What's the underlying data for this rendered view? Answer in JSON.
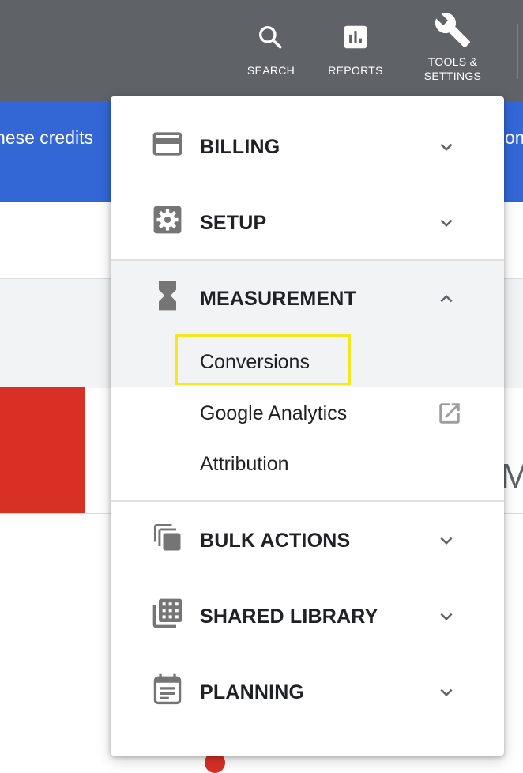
{
  "topbar": {
    "search_label": "SEARCH",
    "reports_label": "REPORTS",
    "tools_label_line1": "TOOLS &",
    "tools_label_line2": "SETTINGS"
  },
  "banner": {
    "left_text": "hese credits",
    "right_text": "om"
  },
  "background": {
    "right_letter": "M"
  },
  "menu": {
    "sections": [
      {
        "label": "BILLING",
        "icon": "credit-card-icon",
        "expanded": false
      },
      {
        "label": "SETUP",
        "icon": "gear-icon",
        "expanded": false
      },
      {
        "label": "MEASUREMENT",
        "icon": "hourglass-icon",
        "expanded": true,
        "items": [
          "Conversions",
          "Google Analytics",
          "Attribution"
        ]
      },
      {
        "label": "BULK ACTIONS",
        "icon": "copy-stack-icon",
        "expanded": false
      },
      {
        "label": "SHARED LIBRARY",
        "icon": "library-grid-icon",
        "expanded": false
      },
      {
        "label": "PLANNING",
        "icon": "calendar-icon",
        "expanded": false
      }
    ],
    "highlighted_item": "Conversions"
  },
  "colors": {
    "topbar": "#5f6368",
    "banner": "#3367d6",
    "highlight": "#f6e71a",
    "red": "#d93025",
    "icon_gray": "#757575"
  }
}
